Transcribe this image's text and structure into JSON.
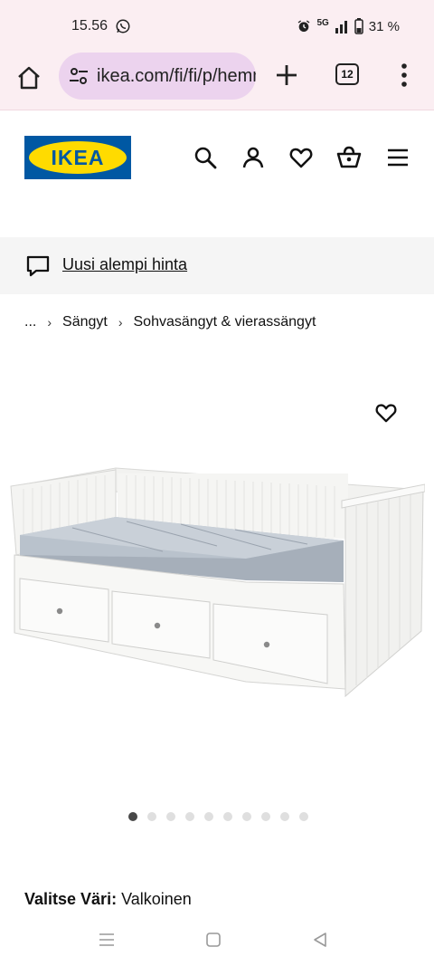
{
  "status_bar": {
    "time": "15.56",
    "network": "5G",
    "battery": "31 %"
  },
  "browser": {
    "url": "ikea.com/fi/fi/p/hemnes",
    "tab_count": "12"
  },
  "site": {
    "logo_text": "IKEA",
    "brand_blue": "#0058a3",
    "brand_yellow": "#ffdb00"
  },
  "promo": {
    "text": "Uusi alempi hinta"
  },
  "breadcrumb": {
    "items": [
      "...",
      "Sängyt",
      "Sohvasängyt & vierassängyt"
    ]
  },
  "gallery": {
    "image_count": 10,
    "active_index": 0
  },
  "product": {
    "color_label": "Valitse Väri:",
    "color_value": "Valkoinen"
  }
}
